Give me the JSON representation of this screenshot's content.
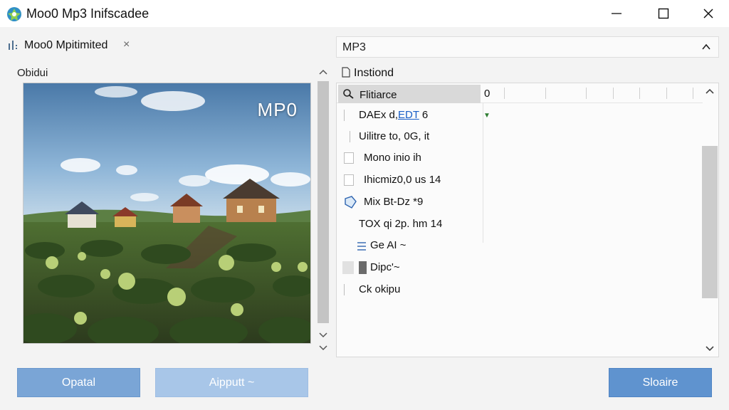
{
  "window": {
    "title": "Moo0 Mp3 Inifscadee",
    "controls": {
      "minimize": "—",
      "maximize": "☐",
      "close": "✕"
    }
  },
  "tab": {
    "label": "Moo0 Mpitimited",
    "close": "×"
  },
  "left_panel": {
    "label": "Obidui",
    "preview_overlay_text": "MP0"
  },
  "format_select": {
    "value": "MP3"
  },
  "settings": {
    "header": "Instiond",
    "columns": {
      "filter_label": "Flitiarce",
      "zero": "0"
    },
    "rows": [
      {
        "prefix": "DAEx d,",
        "link": "EDT",
        "suffix": " 6"
      },
      {
        "text": "Uilitre to, 0G, it"
      },
      {
        "text": "Mono inio ih"
      },
      {
        "text": "Ihicmiz0,0 us 14"
      },
      {
        "text": "Mix Bt-Dz *9"
      },
      {
        "text": "TOX qi 2p. hm 14"
      },
      {
        "text": "Ge AI ~"
      },
      {
        "text": "Dipc'~"
      },
      {
        "text": "Ck okipu"
      }
    ]
  },
  "buttons": {
    "open": "Opatal",
    "adjust": "Aipputt ~",
    "save": "Sloaire"
  },
  "colors": {
    "accent": "#5f93cf",
    "button_light": "#7aa5d6",
    "button_disabled": "#a8c6e8"
  }
}
